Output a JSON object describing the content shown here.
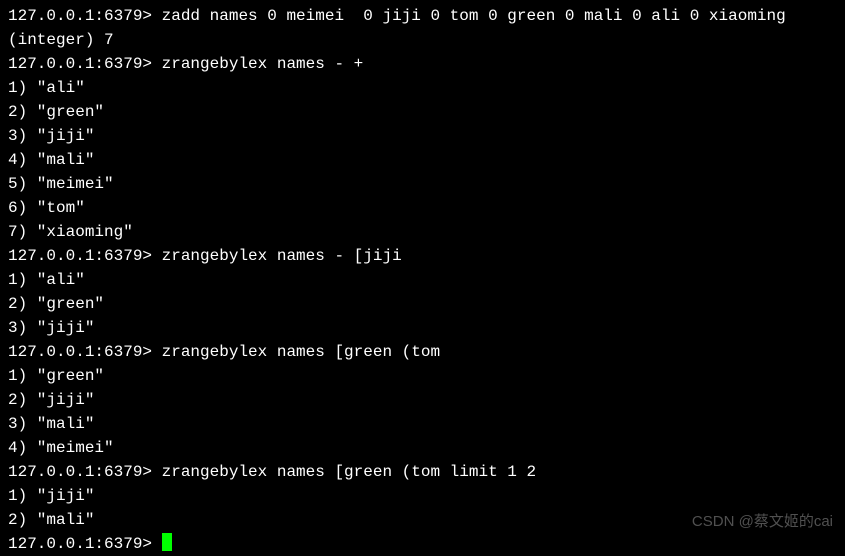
{
  "prompt": "127.0.0.1:6379> ",
  "lines": [
    {
      "type": "cmd",
      "text": "zadd names 0 meimei  0 jiji 0 tom 0 green 0 mali 0 ali 0 xiaoming"
    },
    {
      "type": "out",
      "text": "(integer) 7"
    },
    {
      "type": "cmd",
      "text": "zrangebylex names - +"
    },
    {
      "type": "out",
      "text": "1) \"ali\""
    },
    {
      "type": "out",
      "text": "2) \"green\""
    },
    {
      "type": "out",
      "text": "3) \"jiji\""
    },
    {
      "type": "out",
      "text": "4) \"mali\""
    },
    {
      "type": "out",
      "text": "5) \"meimei\""
    },
    {
      "type": "out",
      "text": "6) \"tom\""
    },
    {
      "type": "out",
      "text": "7) \"xiaoming\""
    },
    {
      "type": "cmd",
      "text": "zrangebylex names - [jiji"
    },
    {
      "type": "out",
      "text": "1) \"ali\""
    },
    {
      "type": "out",
      "text": "2) \"green\""
    },
    {
      "type": "out",
      "text": "3) \"jiji\""
    },
    {
      "type": "cmd",
      "text": "zrangebylex names [green (tom"
    },
    {
      "type": "out",
      "text": "1) \"green\""
    },
    {
      "type": "out",
      "text": "2) \"jiji\""
    },
    {
      "type": "out",
      "text": "3) \"mali\""
    },
    {
      "type": "out",
      "text": "4) \"meimei\""
    },
    {
      "type": "cmd",
      "text": "zrangebylex names [green (tom limit 1 2"
    },
    {
      "type": "out",
      "text": "1) \"jiji\""
    },
    {
      "type": "out",
      "text": "2) \"mali\""
    }
  ],
  "watermark": "CSDN @蔡文姬的cai"
}
